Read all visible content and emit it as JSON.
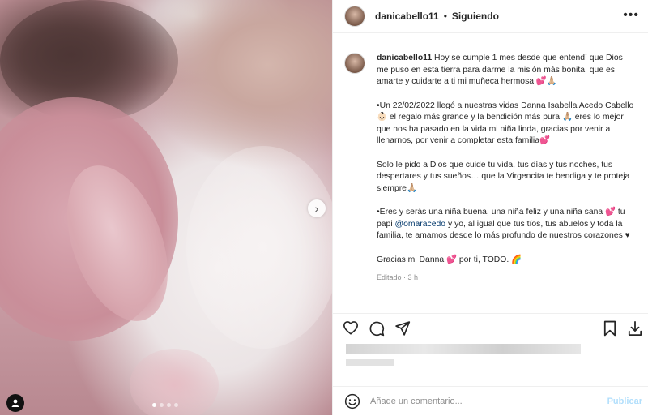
{
  "post": {
    "username": "danicabello11",
    "separator": "•",
    "follow_status": "Siguiendo",
    "more_label": "•••"
  },
  "caption": {
    "username": "danicabello11",
    "p1": "Hoy se cumple 1 mes desde que entendí que Dios me puso en esta tierra para darme la misión más bonita, que es amarte y cuidarte a ti mi muñeca hermosa 💕🙏🏼",
    "p2": "•Un 22/02/2022 llegó a nuestras vidas Danna Isabella Acedo Cabello👶🏻 el regalo más grande y la bendición más pura 🙏🏼 eres lo mejor que nos ha pasado en la vida mi niña linda, gracias por venir a llenarnos, por venir a completar esta familia💕",
    "p3": "Solo le pido a Dios que cuide tu vida, tus días y tus noches, tus despertares y tus sueños… que la Virgencita te bendiga y te proteja siempre🙏🏼",
    "p4_a": "•Eres y serás una niña buena, una niña feliz y una niña sana 💕 tu papi ",
    "p4_mention": "@omaracedo",
    "p4_b": " y yo, al igual que tus tíos, tus abuelos y toda la familia, te amamos desde lo más profundo de nuestros corazones ♥",
    "p5": "Gracias mi Danna 💕 por ti, TODO. 🌈",
    "meta": "Editado · 3 h"
  },
  "actions": {
    "icons": [
      "heart-icon",
      "comment-icon",
      "share-icon",
      "bookmark-icon",
      "download-icon"
    ]
  },
  "comment_box": {
    "placeholder": "Añade un comentario...",
    "publish_label": "Publicar"
  },
  "carousel": {
    "next_arrow": "›",
    "slides": 4,
    "active_slide": 1
  }
}
